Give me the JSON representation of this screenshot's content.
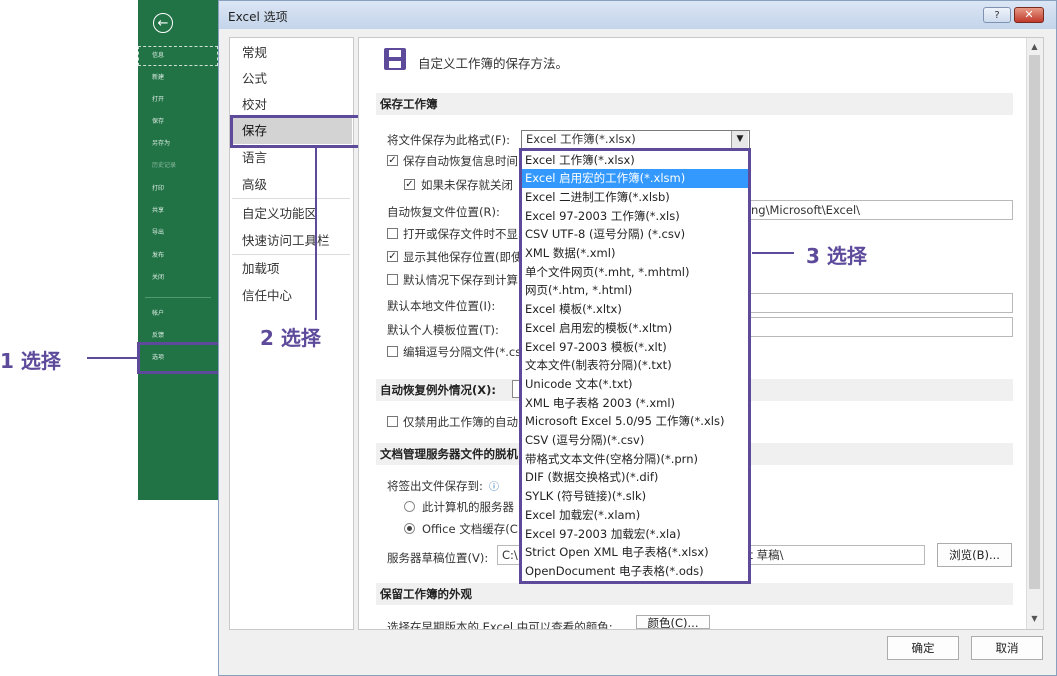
{
  "backstage": {
    "items": [
      "信息",
      "新建",
      "打开",
      "保存",
      "另存为",
      "历史记录",
      "打印",
      "共享",
      "导出",
      "发布",
      "关闭",
      "帐户",
      "反馈",
      "选项"
    ]
  },
  "annotations": {
    "step1": "1 选择",
    "step2": "2 选择",
    "step3": "3 选择"
  },
  "dialog": {
    "title": "Excel 选项",
    "help": "?",
    "close": "✕"
  },
  "categories": [
    "常规",
    "公式",
    "校对",
    "保存",
    "语言",
    "高级",
    "自定义功能区",
    "快速访问工具栏",
    "加载项",
    "信任中心"
  ],
  "main": {
    "heading": "自定义工作簿的保存方法。",
    "section_save": "保存工作簿",
    "save_format_label": "将文件保存为此格式(F):",
    "save_format_value": "Excel 工作簿(*.xlsx)",
    "autorecover_label": "保存自动恢复信息时间",
    "keep_last_label": "如果未保存就关闭",
    "autorecover_location_label": "自动恢复文件位置(R):",
    "autorecover_location_value": "ng\\Microsoft\\Excel\\",
    "no_backstage_label": "打开或保存文件时不显",
    "show_additional_label": "显示其他保存位置(即使",
    "default_computer_label": "默认情况下保存到计算",
    "default_local_label": "默认本地文件位置(I):",
    "default_template_label": "默认个人模板位置(T):",
    "edit_csv_label": "编辑逗号分隔文件(*.cs",
    "section_autorecover_ex": "自动恢复例外情况(X):",
    "disable_autorecover_label": "仅禁用此工作簿的自动",
    "section_offline": "文档管理服务器文件的脱机",
    "checkout_label": "将签出文件保存到:",
    "radio_server_label": "此计算机的服务器",
    "radio_office_label": "Office 文档缓存(C",
    "drafts_label": "服务器草稿位置(V):",
    "drafts_value_left": "C:\\",
    "drafts_value_right": "int 草稿\\",
    "browse_button": "浏览(B)...",
    "section_appearance": "保留工作簿的外观",
    "colors_label": "选择在早期版本的 Excel 中可以查看的颜色:",
    "colors_button": "颜色(C)..."
  },
  "format_options": [
    "Excel 工作簿(*.xlsx)",
    "Excel 启用宏的工作簿(*.xlsm)",
    "Excel 二进制工作簿(*.xlsb)",
    "Excel 97-2003 工作簿(*.xls)",
    "CSV UTF-8 (逗号分隔) (*.csv)",
    "XML 数据(*.xml)",
    "单个文件网页(*.mht, *.mhtml)",
    "网页(*.htm, *.html)",
    "Excel 模板(*.xltx)",
    "Excel 启用宏的模板(*.xltm)",
    "Excel 97-2003 模板(*.xlt)",
    "文本文件(制表符分隔)(*.txt)",
    "Unicode 文本(*.txt)",
    "XML 电子表格 2003 (*.xml)",
    "Microsoft Excel 5.0/95 工作簿(*.xls)",
    "CSV (逗号分隔)(*.csv)",
    "带格式文本文件(空格分隔)(*.prn)",
    "DIF (数据交换格式)(*.dif)",
    "SYLK (符号链接)(*.slk)",
    "Excel 加载宏(*.xlam)",
    "Excel 97-2003 加载宏(*.xla)",
    "Strict Open XML 电子表格(*.xlsx)",
    "OpenDocument 电子表格(*.ods)"
  ],
  "highlighted_option_index": 1,
  "footer": {
    "ok": "确定",
    "cancel": "取消"
  },
  "colors": {
    "backstage_green": "#217346",
    "annotation_purple": "#5d4a9b",
    "highlight_blue": "#3399ff"
  }
}
